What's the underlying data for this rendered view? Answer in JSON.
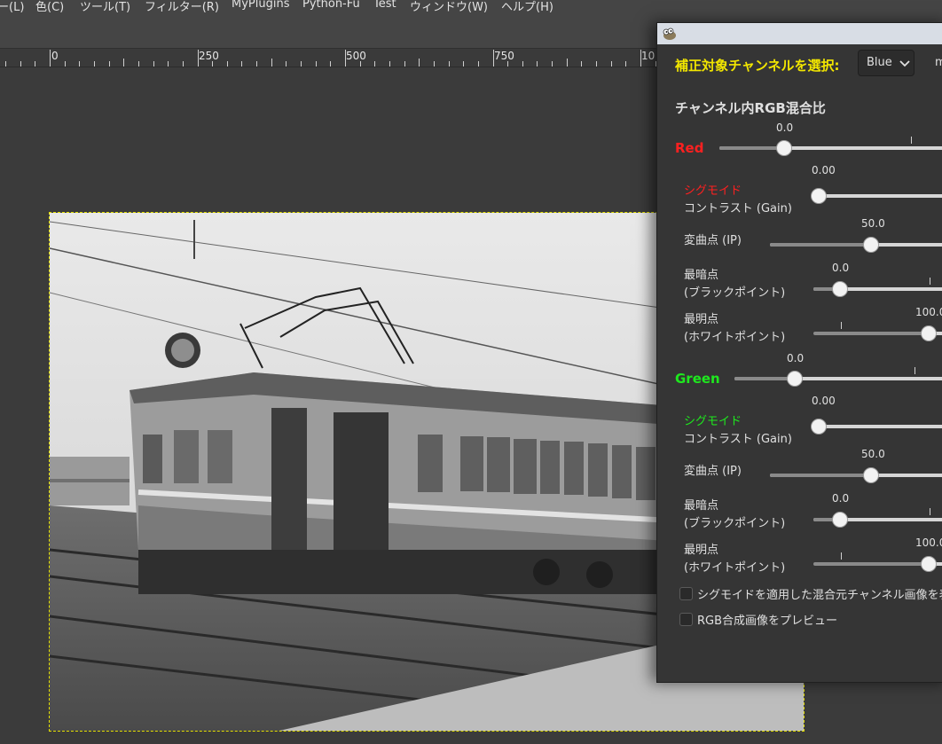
{
  "menubar": {
    "items": [
      "ー(L)",
      "色(C)",
      "ツール(T)",
      "フィルター(R)",
      "MyPlugins",
      "Python-Fu",
      "Test",
      "ウィンドウ(W)",
      "ヘルプ(H)"
    ]
  },
  "ruler": {
    "labels": [
      "0",
      "250",
      "500",
      "750",
      "10"
    ]
  },
  "dialog": {
    "channel_select_label": "補正対象チャンネルを選択:",
    "channel_select_value": "Blue",
    "channel_select_trailing": "m",
    "mix_header": "チャンネル内RGB混合比",
    "groups": [
      {
        "name": "Red",
        "name_color": "#ff2020",
        "mix_value": "0.0",
        "mix_fraction": 0.0,
        "sigmoid_label": "シグモイド",
        "gain_label": "コントラスト (Gain)",
        "gain_value": "0.00",
        "ip_label": "変曲点 (IP)",
        "ip_value": "50.0",
        "black_label1": "最暗点",
        "black_label2": "(ブラックポイント)",
        "black_value": "0.0",
        "white_label1": "最明点",
        "white_label2": "(ホワイトポイント)",
        "white_value": "100.0"
      },
      {
        "name": "Green",
        "name_color": "#1ee81e",
        "mix_value": "0.0",
        "mix_fraction": 0.0,
        "sigmoid_label": "シグモイド",
        "gain_label": "コントラスト (Gain)",
        "gain_value": "0.00",
        "ip_label": "変曲点 (IP)",
        "ip_value": "50.0",
        "black_label1": "最暗点",
        "black_label2": "(ブラックポイント)",
        "black_value": "0.0",
        "white_label1": "最明点",
        "white_label2": "(ホワイトポイント)",
        "white_value": "100.0"
      }
    ],
    "checkbox_sigmoid_preview": "シグモイドを適用した混合元チャンネル画像を表",
    "checkbox_rgb_preview": "RGB合成画像をプレビュー"
  },
  "colors": {
    "accent_yellow": "#f2e600",
    "red": "#ff2020",
    "green": "#1ee81e",
    "selection": "#e4e000"
  },
  "icons": [
    "gimp-wilber-icon",
    "chevron-down-icon"
  ]
}
